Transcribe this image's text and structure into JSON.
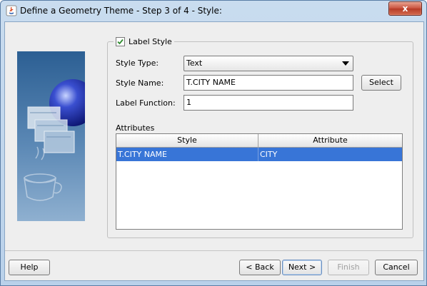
{
  "window": {
    "title": "Define a Geometry Theme - Step 3 of 4 - Style:",
    "close_label": "x"
  },
  "label_style": {
    "legend": "Label Style",
    "checked": true
  },
  "form": {
    "style_type_label": "Style Type:",
    "style_type_value": "Text",
    "style_name_label": "Style Name:",
    "style_name_value": "T.CITY NAME",
    "select_button": "Select",
    "label_function_label": "Label Function:",
    "label_function_value": "1"
  },
  "attributes": {
    "label": "Attributes",
    "columns": [
      "Style",
      "Attribute"
    ],
    "rows": [
      {
        "style": "T.CITY NAME",
        "attribute": "CITY",
        "selected": true
      }
    ]
  },
  "footer": {
    "help": "Help",
    "back": "< Back",
    "next": "Next >",
    "finish": "Finish",
    "cancel": "Cancel"
  },
  "colors": {
    "selection": "#3875d7",
    "title_bar": "#c9dcef",
    "close_button": "#c8503c"
  }
}
